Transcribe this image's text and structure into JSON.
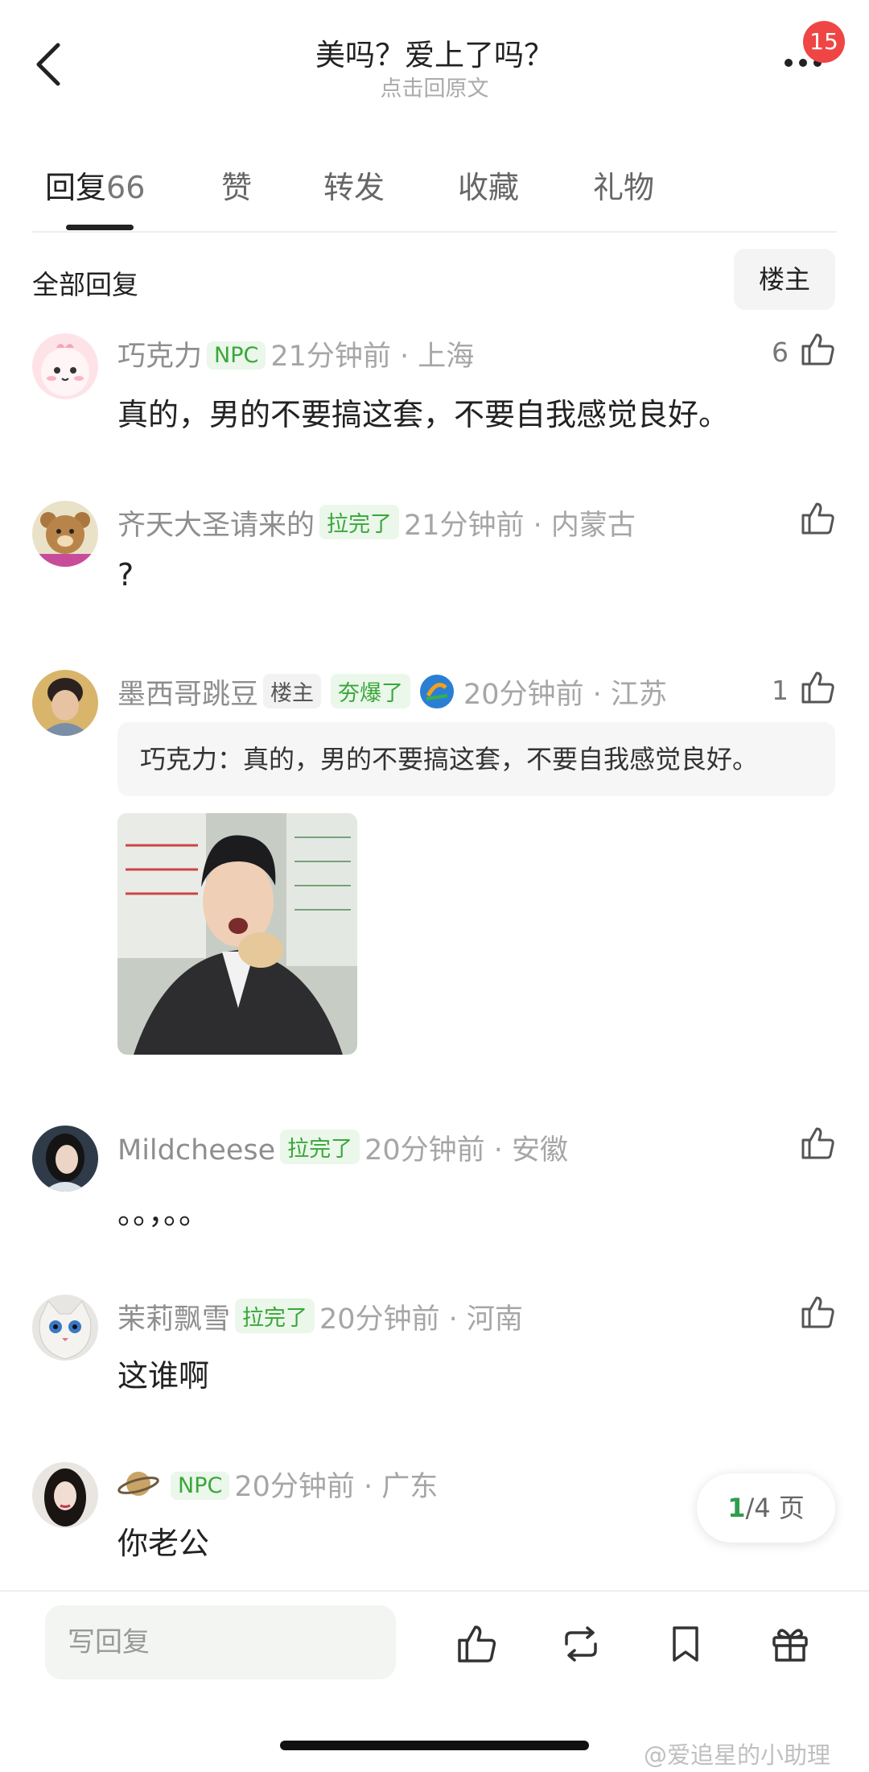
{
  "header": {
    "title": "美吗？爱上了吗？",
    "subtitle": "点击回原文",
    "notification_count": "15"
  },
  "tabs": [
    {
      "label": "回复",
      "count": "66"
    },
    {
      "label": "赞"
    },
    {
      "label": "转发"
    },
    {
      "label": "收藏"
    },
    {
      "label": "礼物"
    }
  ],
  "section": {
    "title": "全部回复",
    "owner_button": "楼主"
  },
  "comments": [
    {
      "name": "巧克力",
      "tags": [
        "NPC"
      ],
      "time_location": "21分钟前 · 上海",
      "likes": "6",
      "text": "真的，男的不要搞这套，不要自我感觉良好。"
    },
    {
      "name": "齐天大圣请来的",
      "tags": [
        "拉完了"
      ],
      "time_location": "21分钟前 · 内蒙古",
      "likes": "",
      "text": "?"
    },
    {
      "name": "墨西哥跳豆",
      "tags": [
        "楼主",
        "夯爆了"
      ],
      "time_location": "20分钟前 · 江苏",
      "likes": "1",
      "quote": "巧克力：真的，男的不要搞这套，不要自我感觉良好。"
    },
    {
      "name": "Mildcheese",
      "tags": [
        "拉完了"
      ],
      "time_location": "20分钟前 · 安徽",
      "likes": "",
      "text": "。。，。。"
    },
    {
      "name": "茉莉飘雪",
      "tags": [
        "拉完了"
      ],
      "time_location": "20分钟前 · 河南",
      "likes": "",
      "text": "这谁啊"
    },
    {
      "name": "",
      "tags": [
        "NPC"
      ],
      "time_location": "20分钟前 · 广东",
      "likes": "",
      "text": "你老公"
    }
  ],
  "pager": {
    "current": "1",
    "total": "/4 页"
  },
  "bottom_bar": {
    "reply_placeholder": "写回复"
  },
  "watermark": "@爱追星的小助理",
  "colors": {
    "accent_green": "#3aa63a",
    "badge_red": "#f04545"
  }
}
